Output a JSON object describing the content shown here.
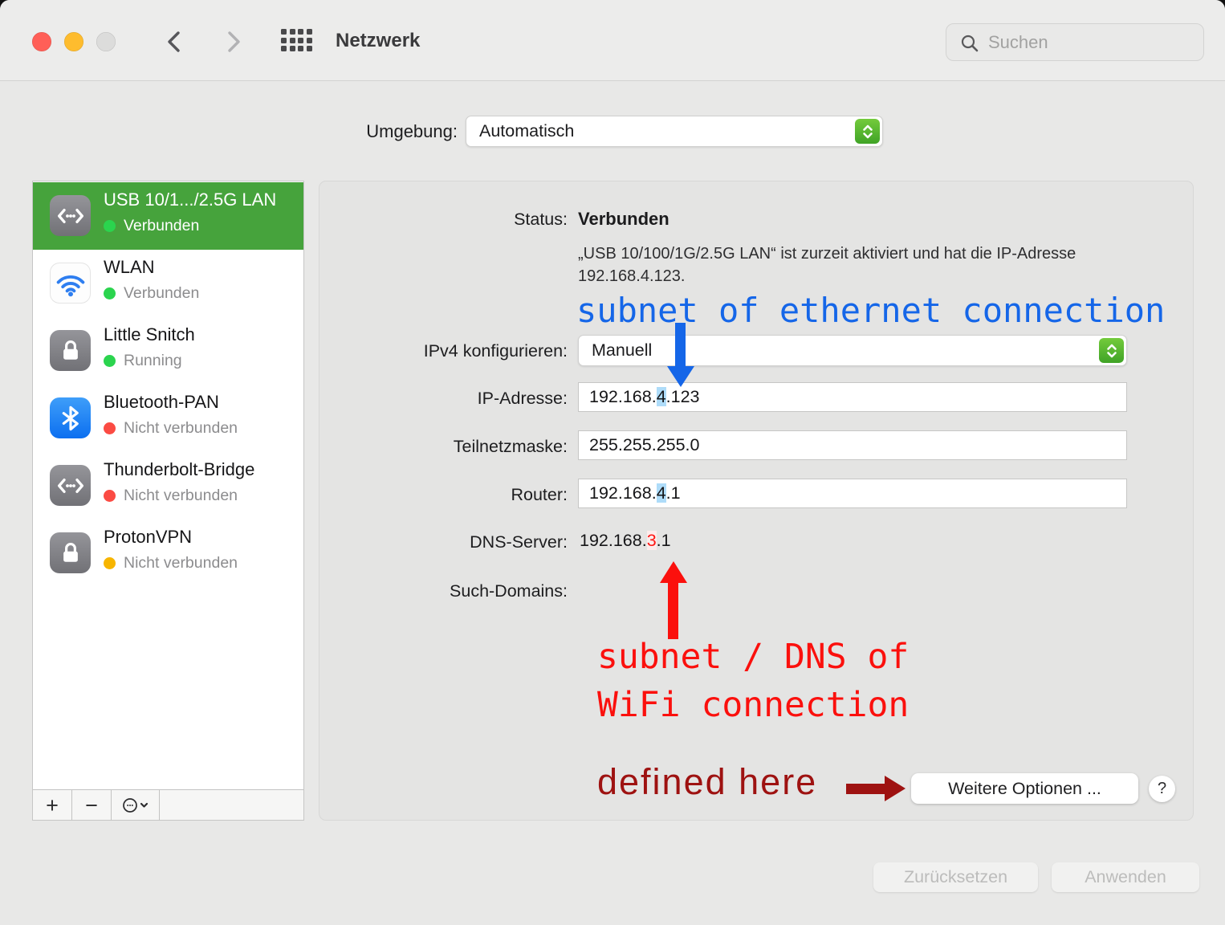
{
  "window": {
    "title": "Netzwerk",
    "search_placeholder": "Suchen"
  },
  "environment": {
    "label": "Umgebung:",
    "value": "Automatisch"
  },
  "sidebar": {
    "items": [
      {
        "name": "USB 10/1.../2.5G LAN",
        "status": "Verbunden",
        "status_color": "green",
        "icon": "ethernet-icon",
        "selected": true
      },
      {
        "name": "WLAN",
        "status": "Verbunden",
        "status_color": "green",
        "icon": "wifi-icon",
        "selected": false
      },
      {
        "name": "Little Snitch",
        "status": "Running",
        "status_color": "green",
        "icon": "lock-icon",
        "selected": false
      },
      {
        "name": "Bluetooth-PAN",
        "status": "Nicht verbunden",
        "status_color": "red",
        "icon": "bluetooth-icon",
        "selected": false
      },
      {
        "name": "Thunderbolt-Bridge",
        "status": "Nicht verbunden",
        "status_color": "red",
        "icon": "ethernet-icon",
        "selected": false
      },
      {
        "name": "ProtonVPN",
        "status": "Nicht verbunden",
        "status_color": "orange",
        "icon": "lock-icon",
        "selected": false
      }
    ],
    "actions": {
      "add": "+",
      "remove": "−"
    }
  },
  "form": {
    "status": {
      "label": "Status:",
      "value": "Verbunden",
      "description": "„USB 10/100/1G/2.5G LAN“ ist zurzeit aktiviert und hat die IP-Adresse 192.168.4.123."
    },
    "ipv4": {
      "label": "IPv4 konfigurieren:",
      "value": "Manuell"
    },
    "ip": {
      "label": "IP-Adresse:",
      "pre": "192.168.",
      "hl": "4",
      "post": ".123"
    },
    "mask": {
      "label": "Teilnetzmaske:",
      "value": "255.255.255.0"
    },
    "router": {
      "label": "Router:",
      "pre": "192.168.",
      "hl": "4",
      "post": ".1"
    },
    "dns": {
      "label": "DNS-Server:",
      "pre": "192.168.",
      "hl": "3",
      "post": ".1"
    },
    "domains": {
      "label": "Such-Domains:"
    },
    "advanced_button": "Weitere Optionen ...",
    "help_button": "?"
  },
  "footer": {
    "reset": "Zurücksetzen",
    "apply": "Anwenden"
  },
  "annotations": {
    "blue_note": "subnet of ethernet connection",
    "red_note_line1": "subnet / DNS of",
    "red_note_line2": "WiFi connection",
    "darkred_note": "defined here",
    "colors": {
      "blue": "#1566e8",
      "red": "#fb100d",
      "dark_red": "#9e1211",
      "ip_highlight": "#aedcf9",
      "dns_highlight_bg": "#fcecec",
      "selected_row": "#46a33c",
      "accent_stepper": "#4fb02e"
    }
  }
}
